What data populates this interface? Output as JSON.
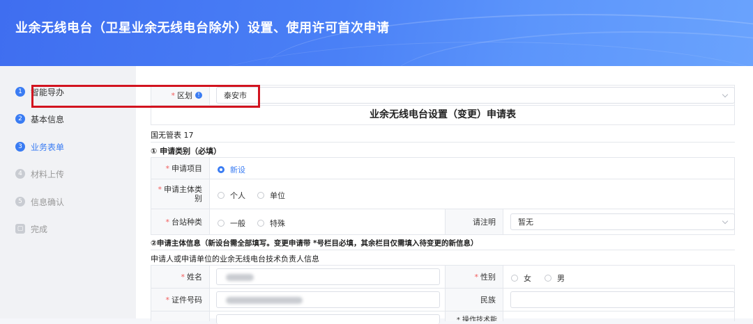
{
  "header": {
    "title": "业余无线电台（卫星业余无线电台除外）设置、使用许可首次申请"
  },
  "steps": [
    {
      "num": "1",
      "label": "智能导办"
    },
    {
      "num": "2",
      "label": "基本信息"
    },
    {
      "num": "3",
      "label": "业务表单"
    },
    {
      "num": "4",
      "label": "材料上传"
    },
    {
      "num": "5",
      "label": "信息确认"
    },
    {
      "num": "▢",
      "label": "完成"
    }
  ],
  "form": {
    "district_label": "区划",
    "district_value": "泰安市",
    "form_title": "业余无线电台设置（变更）申请表",
    "form_code": "国无管表 17",
    "section1": "① 申请类别（必填）",
    "apply_item_label": "申请项目",
    "apply_item_option": "新设",
    "subject_label": "申请主体类别",
    "subject_options": [
      "个人",
      "单位"
    ],
    "station_label": "台站种类",
    "station_options": [
      "一般",
      "特殊"
    ],
    "note_label": "请注明",
    "note_value": "暂无",
    "section2": "②申请主体信息（新设台需全部填写。变更申请带 *号栏目必填，其余栏目仅需填入待变更的新信息）",
    "tech_lead": "申请人或申请单位的业余无线电台技术负责人信息",
    "name_label": "姓名",
    "gender_label": "性别",
    "gender_options": [
      "女",
      "男"
    ],
    "id_label": "证件号码",
    "ethnic_label": "民族",
    "next_label_partial": "* 操作技术能"
  }
}
